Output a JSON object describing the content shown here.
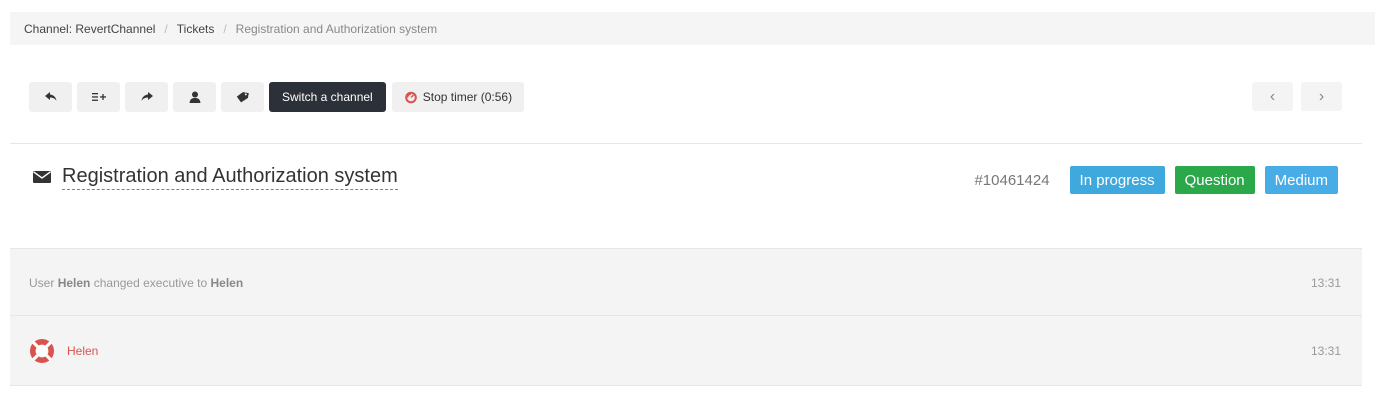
{
  "breadcrumb": {
    "items": [
      "Channel: RevertChannel",
      "Tickets",
      "Registration and Authorization system"
    ],
    "separator": "/"
  },
  "toolbar": {
    "reply_icon": "reply-icon",
    "add_note_icon": "list-add-icon",
    "forward_icon": "forward-icon",
    "assign_icon": "user-icon",
    "tag_icon": "tag-icon",
    "switch_label": "Switch a channel",
    "timer_label": "Stop timer (0:56)",
    "timer_icon": "stopwatch-icon"
  },
  "nav": {
    "prev": "‹",
    "next": "›"
  },
  "ticket": {
    "title": "Registration and Authorization system",
    "id": "#10461424",
    "badges": [
      {
        "label": "In progress",
        "color": "#3fa9dd"
      },
      {
        "label": "Question",
        "color": "#2aa84a"
      },
      {
        "label": "Medium",
        "color": "#48ace6"
      }
    ]
  },
  "activity": [
    {
      "prefix": "User",
      "actor": "Helen",
      "middle": "changed executive to",
      "target": "Helen",
      "time": "13:31"
    },
    {
      "user": "Helen",
      "icon": "lifebuoy-icon",
      "time": "13:31"
    }
  ],
  "colors": {
    "accent_red": "#d9534f",
    "dark_button": "#2c3038"
  }
}
